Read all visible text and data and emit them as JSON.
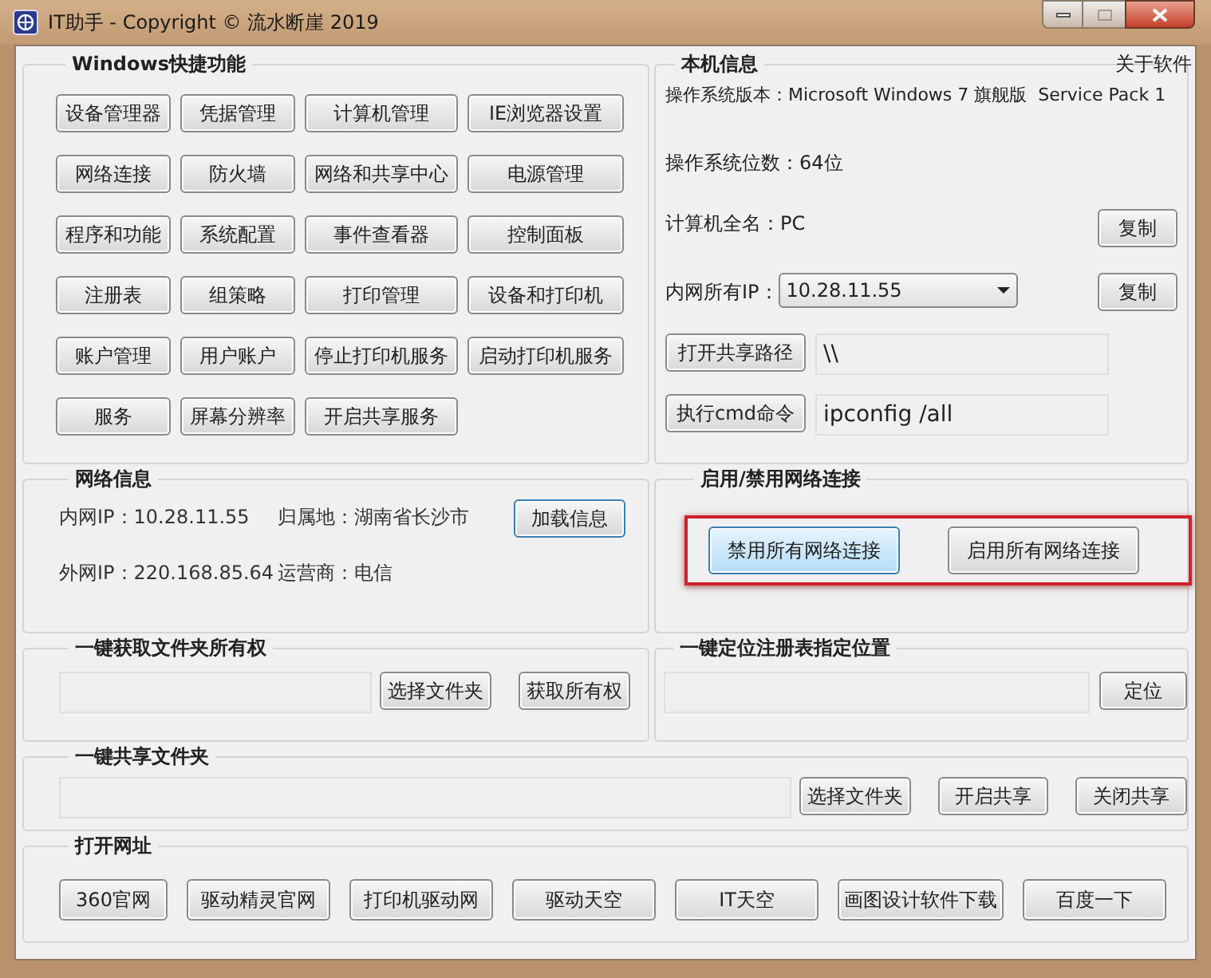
{
  "window": {
    "title": "IT助手 - Copyright © 流水断崖 2019"
  },
  "about_link": "关于软件",
  "shortcuts": {
    "title": "Windows快捷功能",
    "rows": [
      [
        "设备管理器",
        "凭据管理",
        "计算机管理",
        "IE浏览器设置"
      ],
      [
        "网络连接",
        "防火墙",
        "网络和共享中心",
        "电源管理"
      ],
      [
        "程序和功能",
        "系统配置",
        "事件查看器",
        "控制面板"
      ],
      [
        "注册表",
        "组策略",
        "打印管理",
        "设备和打印机"
      ],
      [
        "账户管理",
        "用户账户",
        "停止打印机服务",
        "启动打印机服务"
      ],
      [
        "服务",
        "屏幕分辨率",
        "开启共享服务"
      ]
    ]
  },
  "machine_info": {
    "title": "本机信息",
    "os_version": "操作系统版本：Microsoft Windows 7 旗舰版  Service Pack 1",
    "os_bits": "操作系统位数：64位",
    "computer_name": "计算机全名：PC",
    "copy_name_button": "复制",
    "ip_label": "内网所有IP：",
    "ip_value": "10.28.11.55",
    "copy_ip_button": "复制",
    "share_button": "打开共享路径",
    "share_path": "\\\\",
    "cmd_button": "执行cmd命令",
    "cmd_value": "ipconfig /all"
  },
  "network_info": {
    "title": "网络信息",
    "lan_ip": "内网IP：10.28.11.55",
    "location": "归属地：湖南省长沙市",
    "wan_ip": "外网IP：220.168.85.64",
    "isp": "运营商：电信",
    "load_button": "加载信息"
  },
  "network_toggle": {
    "title": "启用/禁用网络连接",
    "highlighted": true,
    "buttons": [
      {
        "label": "禁用所有网络连接",
        "selected": true
      },
      {
        "label": "启用所有网络连接",
        "selected": false
      }
    ]
  },
  "ownership": {
    "title": "一键获取文件夹所有权",
    "choose_button": "选择文件夹",
    "take_button": "获取所有权"
  },
  "registry": {
    "title": "一键定位注册表指定位置",
    "locate_button": "定位"
  },
  "share_folder": {
    "title": "一键共享文件夹",
    "buttons": [
      "选择文件夹",
      "开启共享",
      "关闭共享"
    ]
  },
  "websites": {
    "title": "打开网址",
    "buttons": [
      "360官网",
      "驱动精灵官网",
      "打印机驱动网",
      "驱动天空",
      "IT天空",
      "画图设计软件下载",
      "百度一下"
    ]
  }
}
